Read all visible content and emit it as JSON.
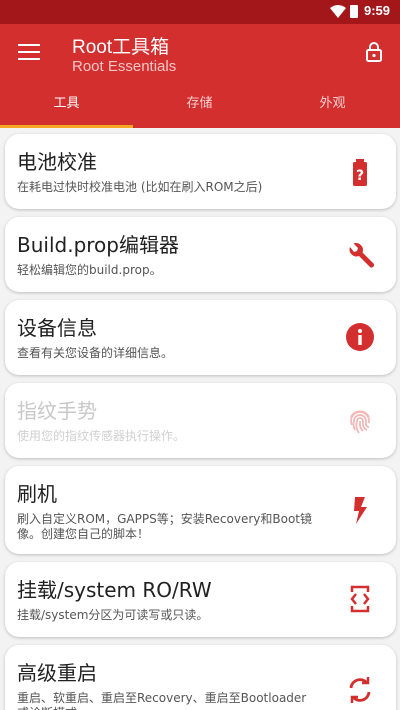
{
  "status_bar": {
    "time": "9:59"
  },
  "app_bar": {
    "title": "Root工具箱",
    "subtitle": "Root Essentials"
  },
  "tabs": [
    {
      "label": "工具",
      "active": true
    },
    {
      "label": "存储",
      "active": false
    },
    {
      "label": "外观",
      "active": false
    }
  ],
  "tools": [
    {
      "title": "电池校准",
      "description": "在耗电过快时校准电池 (比如在刷入ROM之后)",
      "icon": "battery-alert-icon",
      "enabled": true
    },
    {
      "title": "Build.prop编辑器",
      "description": "轻松编辑您的build.prop。",
      "icon": "wrench-icon",
      "enabled": true
    },
    {
      "title": "设备信息",
      "description": "查看有关您设备的详细信息。",
      "icon": "info-icon",
      "enabled": true
    },
    {
      "title": "指纹手势",
      "description": "使用您的指纹传感器执行操作。",
      "icon": "fingerprint-icon",
      "enabled": false
    },
    {
      "title": "刷机",
      "description": "刷入自定义ROM，GAPPS等；安装Recovery和Boot镜像。创建您自己的脚本！",
      "icon": "flash-icon",
      "enabled": true
    },
    {
      "title": "挂载/system RO/RW",
      "description": "挂载/system分区为可读写或只读。",
      "icon": "mount-icon",
      "enabled": true
    },
    {
      "title": "高级重启",
      "description": "重启、软重启、重启至Recovery、重启至Bootloader或诊断模式",
      "icon": "restart-icon",
      "enabled": true
    }
  ],
  "colors": {
    "primary": "#d32f2f",
    "status_bar": "#a3171b",
    "tab_indicator": "#f5a623",
    "icon": "#d32f2f",
    "disabled_icon": "#f2b8b8"
  }
}
